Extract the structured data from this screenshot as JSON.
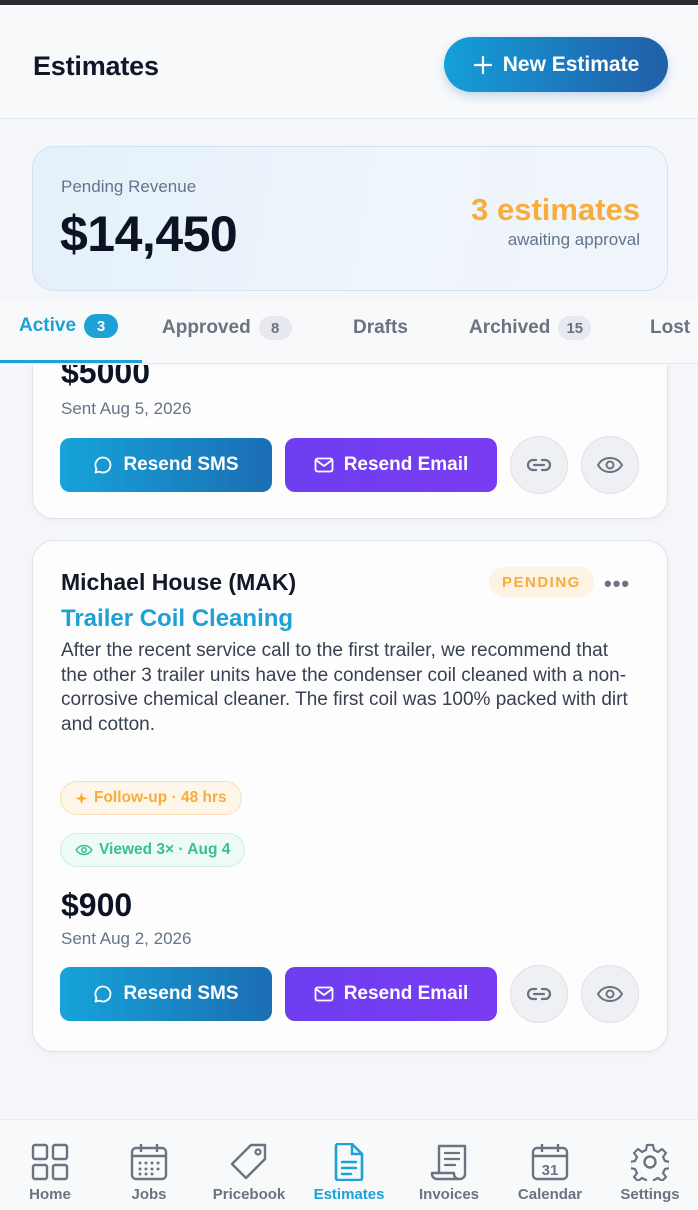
{
  "header": {
    "title": "Estimates",
    "new_button_label": "New Estimate"
  },
  "revenue": {
    "label": "Pending Revenue",
    "amount": "$14,450",
    "count": "3 estimates",
    "sub": "awaiting approval"
  },
  "tabs": [
    {
      "label": "Active",
      "count": "3",
      "active": true
    },
    {
      "label": "Approved",
      "count": "8"
    },
    {
      "label": "Drafts",
      "count": ""
    },
    {
      "label": "Archived",
      "count": "15"
    },
    {
      "label": "Lost",
      "count": ""
    }
  ],
  "cards": [
    {
      "amount": "$5000",
      "sent": "Sent Aug 5, 2026",
      "sms_label": "Resend SMS",
      "email_label": "Resend Email"
    },
    {
      "customer": "Michael House (MAK)",
      "status": "PENDING",
      "more": "•••",
      "title": "Trailer Coil Cleaning",
      "description": "After the recent service call to the first trailer, we recommend that the other 3 trailer units have the condenser coil cleaned with a non-corrosive chemical cleaner.  The first coil was 100% packed with dirt and cotton.",
      "follow_up": "Follow-up · 48 hrs",
      "viewed": "Viewed 3× · Aug 4",
      "amount": "$900",
      "sent": "Sent Aug 2, 2026",
      "sms_label": "Resend SMS",
      "email_label": "Resend Email"
    }
  ],
  "nav": [
    {
      "label": "Home",
      "icon": "grid-icon"
    },
    {
      "label": "Jobs",
      "icon": "calendar-grid-icon"
    },
    {
      "label": "Pricebook",
      "icon": "tag-icon"
    },
    {
      "label": "Estimates",
      "icon": "document-icon",
      "active": true
    },
    {
      "label": "Invoices",
      "icon": "receipt-icon"
    },
    {
      "label": "Calendar",
      "icon": "calendar-icon"
    },
    {
      "label": "Settings",
      "icon": "gear-icon"
    }
  ],
  "calendar_day": "31",
  "colors": {
    "accent": "#1da1d6",
    "purple": "#7a3cf2",
    "pending": "#f6ad3c",
    "viewed": "#38c08e"
  }
}
